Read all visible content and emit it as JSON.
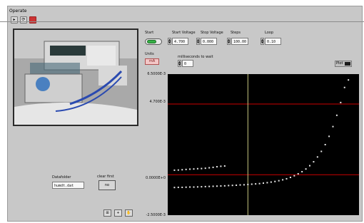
{
  "window": {
    "menu_label": "Operate"
  },
  "toolbar": {
    "icons": [
      "run-arrow-icon",
      "run-continuous-icon",
      "stop-icon"
    ],
    "stop_color": "#cc3333"
  },
  "controls": {
    "start_label": "Start",
    "start_voltage_label": "Start Voltage",
    "start_voltage_value": "4.700",
    "stop_voltage_label": "Stop Voltage",
    "stop_voltage_value": "0.000",
    "steps_label": "Steps",
    "steps_value": "100.00",
    "loop_label": "Loop",
    "loop_value": "0.10",
    "units_label": "Units",
    "units_value": "mA",
    "millisec_label": "milliseconds to wait",
    "millisec_value": "0"
  },
  "file": {
    "label": "Datafolder",
    "value": "humdt.dat"
  },
  "clear": {
    "label": "clear first",
    "button_label": "no"
  },
  "graph": {
    "legend_label": "Plot",
    "legend_color": "#1a1a1a"
  },
  "chart_data": {
    "type": "scatter",
    "y_ticks": [
      "6.5000E-3",
      "4.700E-3",
      "0.0000E+0",
      "-2.5000E-3"
    ],
    "series": [
      {
        "values": [
          [
            0.1,
            -0.85
          ],
          [
            0.2,
            -0.84
          ],
          [
            0.3,
            -0.84
          ],
          [
            0.4,
            -0.83
          ],
          [
            0.5,
            -0.82
          ],
          [
            0.6,
            -0.82
          ],
          [
            0.7,
            -0.81
          ],
          [
            0.8,
            -0.8
          ],
          [
            0.9,
            -0.79
          ],
          [
            1.0,
            -0.78
          ],
          [
            1.1,
            -0.77
          ],
          [
            1.2,
            -0.76
          ],
          [
            1.3,
            -0.75
          ],
          [
            1.4,
            -0.74
          ],
          [
            1.5,
            -0.72
          ],
          [
            1.6,
            -0.71
          ],
          [
            1.7,
            -0.7
          ],
          [
            1.8,
            -0.68
          ],
          [
            1.9,
            -0.67
          ],
          [
            2.0,
            -0.65
          ],
          [
            2.1,
            -0.63
          ],
          [
            2.2,
            -0.61
          ],
          [
            2.3,
            -0.59
          ],
          [
            2.4,
            -0.56
          ],
          [
            2.5,
            -0.53
          ],
          [
            2.6,
            -0.49
          ],
          [
            2.7,
            -0.45
          ],
          [
            2.8,
            -0.4
          ],
          [
            2.9,
            -0.34
          ],
          [
            3.0,
            -0.27
          ],
          [
            3.1,
            -0.18
          ],
          [
            3.2,
            -0.07
          ],
          [
            3.3,
            0.06
          ],
          [
            3.4,
            0.2
          ],
          [
            3.5,
            0.38
          ],
          [
            3.6,
            0.6
          ],
          [
            3.7,
            0.86
          ],
          [
            3.8,
            1.18
          ],
          [
            3.9,
            1.55
          ],
          [
            4.0,
            2.0
          ],
          [
            4.1,
            2.55
          ],
          [
            4.2,
            3.2
          ],
          [
            4.3,
            3.95
          ],
          [
            4.4,
            4.8
          ],
          [
            4.5,
            5.8
          ],
          [
            4.6,
            6.3
          ]
        ]
      },
      {
        "values": [
          [
            0.1,
            0.3
          ],
          [
            0.2,
            0.31
          ],
          [
            0.3,
            0.33
          ],
          [
            0.4,
            0.35
          ],
          [
            0.5,
            0.37
          ],
          [
            0.6,
            0.38
          ],
          [
            0.7,
            0.4
          ],
          [
            0.8,
            0.41
          ],
          [
            0.9,
            0.43
          ],
          [
            1.0,
            0.46
          ],
          [
            1.1,
            0.49
          ],
          [
            1.2,
            0.53
          ],
          [
            1.3,
            0.56
          ],
          [
            1.4,
            0.58
          ]
        ]
      }
    ],
    "ylim": [
      -2.5,
      6.5
    ],
    "xlim": [
      0,
      4.8
    ],
    "reference_lines": [
      4.7,
      0.0
    ],
    "reference_color": "#cc0000",
    "cursor_x": 2.0,
    "cursor_color": "#c8c880",
    "grid": false
  }
}
